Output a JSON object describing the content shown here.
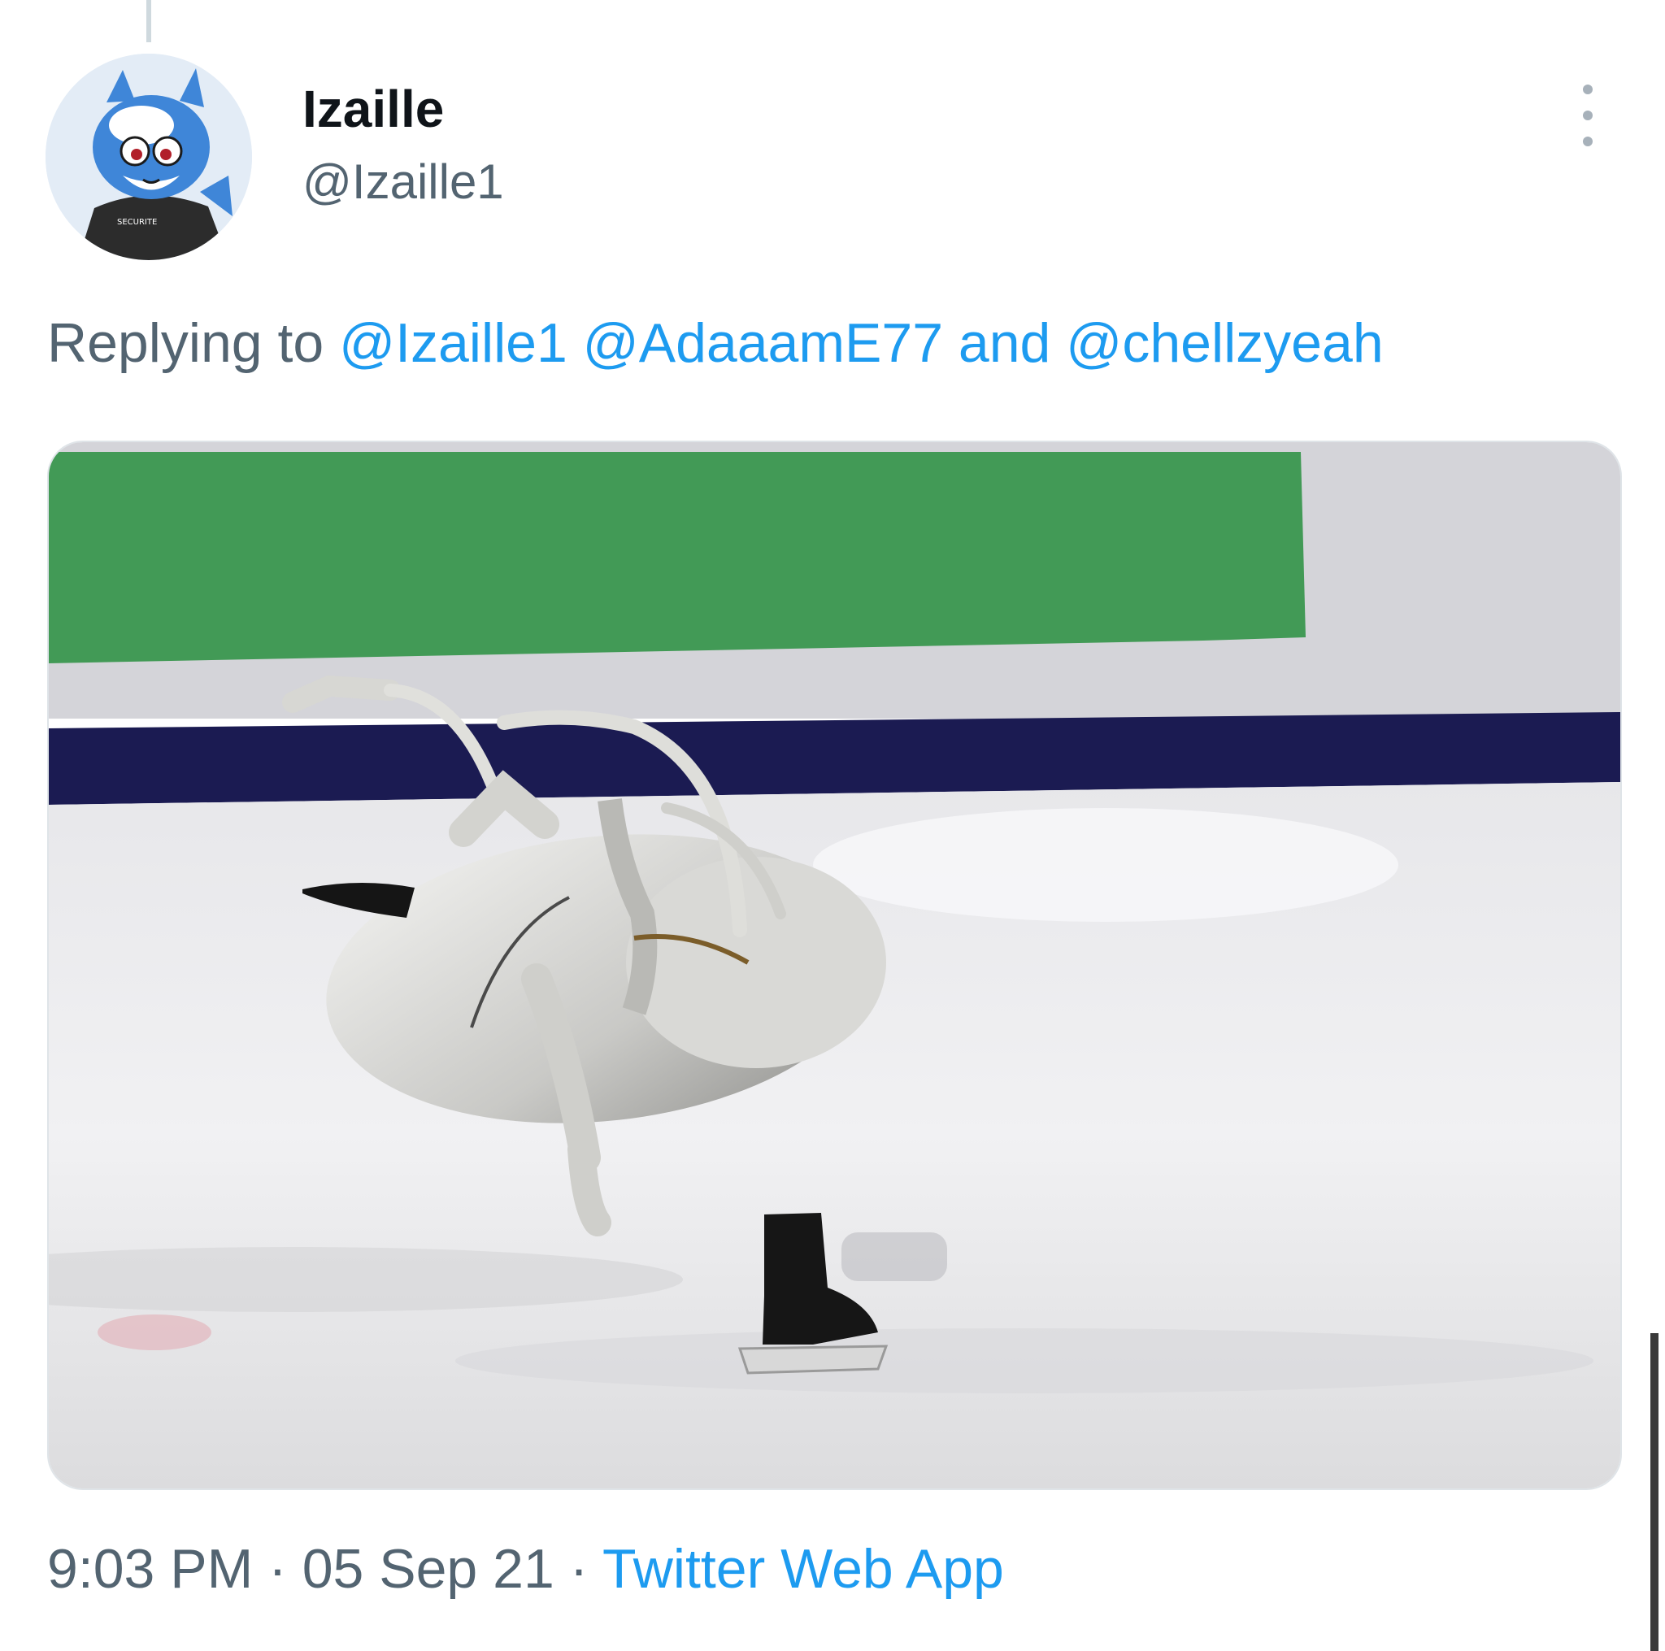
{
  "tweet": {
    "display_name": "Izaille",
    "handle": "@Izaille1",
    "avatar_shirt_text": "SECURITE",
    "reply": {
      "prefix": "Replying to",
      "mention_1": "@Izaille1",
      "mention_2": "@AdaaamE77",
      "and": "and",
      "mention_3": "@chellzyeah"
    },
    "media_description": "figure-skating-cockroach-meme",
    "time": "9:03 PM",
    "separator": "·",
    "date": "05 Sep 21",
    "source": "Twitter Web App"
  },
  "colors": {
    "link": "#1d9bf0",
    "secondary_text": "#536471",
    "primary_text": "#0f1419",
    "rink_banner_green": "#429a56",
    "rink_board_navy": "#1b1b52"
  },
  "icons": {
    "more": "more-vertical-icon"
  }
}
